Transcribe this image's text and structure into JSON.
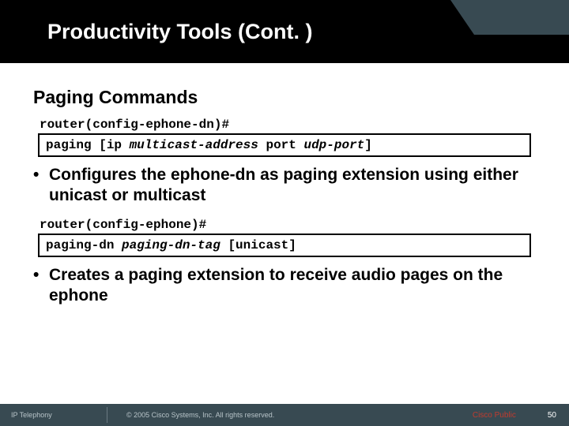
{
  "slide": {
    "title": "Productivity Tools (Cont. )",
    "subtitle": "Paging Commands",
    "prompt1": "router(config-ephone-dn)#",
    "cmd1": {
      "kw1": "paging [ip ",
      "arg1": "multicast-address",
      "kw2": " port ",
      "arg2": "udp-port",
      "kw3": "]"
    },
    "bullet1": "Configures the ephone-dn as paging extension using either unicast or multicast",
    "prompt2": "router(config-ephone)#",
    "cmd2": {
      "kw1": "paging-dn ",
      "arg1": "paging-dn-tag",
      "kw2": " [unicast]"
    },
    "bullet2": "Creates a paging extension to receive audio pages on the ephone"
  },
  "footer": {
    "left": "IP Telephony",
    "center": "© 2005 Cisco Systems, Inc. All rights reserved.",
    "public": "Cisco Public",
    "pagenum": "50"
  }
}
